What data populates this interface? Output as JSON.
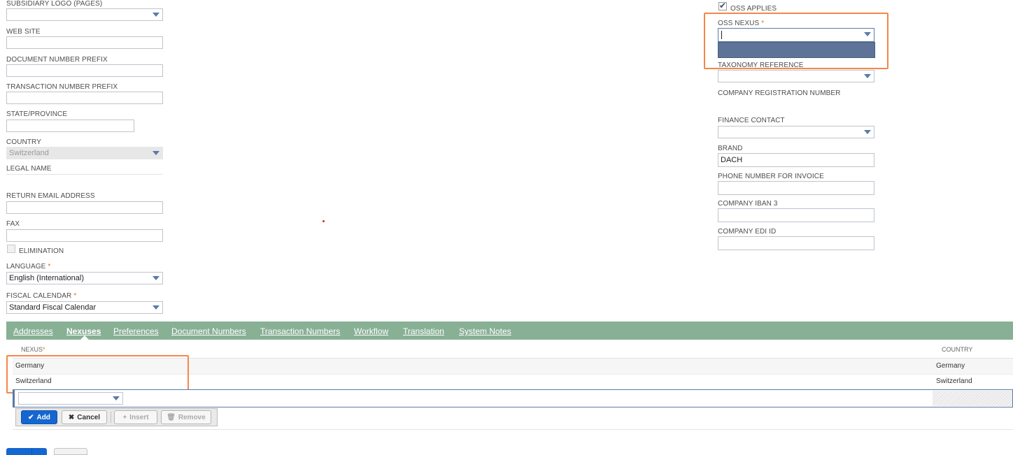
{
  "left_fields": {
    "subsidiary_logo": {
      "label": "SUBSIDIARY LOGO (PAGES)",
      "value": ""
    },
    "web_site": {
      "label": "WEB SITE",
      "value": ""
    },
    "doc_prefix": {
      "label": "DOCUMENT NUMBER PREFIX",
      "value": ""
    },
    "txn_prefix": {
      "label": "TRANSACTION NUMBER PREFIX",
      "value": ""
    },
    "state": {
      "label": "STATE/PROVINCE",
      "value": ""
    },
    "country": {
      "label": "COUNTRY",
      "value": "Switzerland"
    },
    "legal_name": {
      "label": "LEGAL NAME",
      "value": ""
    },
    "return_email": {
      "label": "RETURN EMAIL ADDRESS",
      "value": ""
    },
    "fax": {
      "label": "FAX",
      "value": ""
    },
    "elimination": {
      "label": "ELIMINATION",
      "checked": false
    },
    "language": {
      "label": "LANGUAGE",
      "required": "*",
      "value": "English (International)"
    },
    "fiscal_calendar": {
      "label": "FISCAL CALENDAR",
      "required": "*",
      "value": "Standard Fiscal Calendar"
    }
  },
  "right_fields": {
    "oss_applies": {
      "label": "OSS APPLIES",
      "checked": true
    },
    "oss_nexus": {
      "label": "OSS NEXUS",
      "required": "*",
      "value": ""
    },
    "taxonomy": {
      "label": "TAXONOMY REFERENCE",
      "value": ""
    },
    "company_reg": {
      "label": "COMPANY REGISTRATION NUMBER",
      "value": ""
    },
    "finance_contact": {
      "label": "FINANCE CONTACT",
      "value": ""
    },
    "brand": {
      "label": "BRAND",
      "value": "DACH"
    },
    "phone_invoice": {
      "label": "PHONE NUMBER FOR INVOICE",
      "value": ""
    },
    "iban3": {
      "label": "COMPANY IBAN 3",
      "value": ""
    },
    "edi_id": {
      "label": "COMPANY EDI ID",
      "value": ""
    }
  },
  "tabs": [
    "Addresses",
    "Nexuses",
    "Preferences",
    "Document Numbers",
    "Transaction Numbers",
    "Workflow",
    "Translation",
    "System Notes"
  ],
  "active_tab": "Nexuses",
  "nexus_grid": {
    "columns": {
      "nexus": "NEXUS",
      "nexus_required": "*",
      "country": "COUNTRY"
    },
    "rows": [
      {
        "nexus": "Germany",
        "country": "Germany"
      },
      {
        "nexus": "Switzerland",
        "country": "Switzerland"
      }
    ]
  },
  "buttons": {
    "add": "Add",
    "cancel": "Cancel",
    "insert": "Insert",
    "remove": "Remove"
  },
  "colors": {
    "tab_bar": "#88b095",
    "highlight": "#f5864a",
    "primary_button": "#1467d0",
    "dropdown_selected": "#5d7498"
  }
}
